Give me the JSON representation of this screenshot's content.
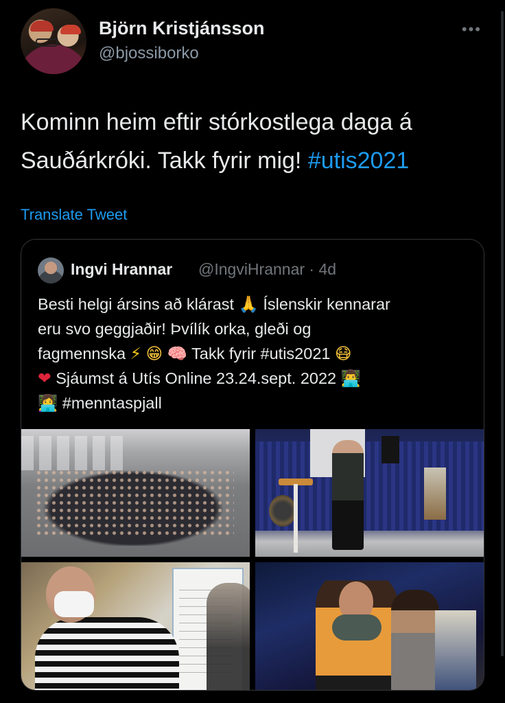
{
  "tweet": {
    "display_name": "Björn Kristjánsson",
    "handle": "@bjossiborko",
    "more_label": "•••",
    "text_part1": "Kominn heim eftir stórkostlega daga á Sauðárkróki. Takk fyrir mig! ",
    "hashtag": "#utis2021",
    "translate_label": "Translate Tweet"
  },
  "quote": {
    "display_name": "Ingvi Hrannar",
    "handle": "@IngviHrannar · 4d",
    "line1": "Besti helgi ársins að klárast",
    "line1b": "Íslenskir kennarar",
    "line2": "eru svo geggjaðir! Þvílík orka, gleði og",
    "line3a": "fagmennska",
    "line3b": "Takk fyrir #utis2021",
    "line4": "Sjáumst á Utís Online 23.24.sept. 2022",
    "line5": "#menntaspjall",
    "emoji": {
      "pray": "🙏",
      "bolt": "⚡",
      "grin": "😁",
      "brain": "🧠",
      "mask": "😷",
      "heart": "❤",
      "man_laptop": "👨‍💻",
      "woman_laptop": "👩‍💻"
    }
  },
  "colors": {
    "background": "#000000",
    "text": "#e7e9ea",
    "secondary": "#8b98a5",
    "link": "#1d9bf0",
    "border": "#333639"
  }
}
